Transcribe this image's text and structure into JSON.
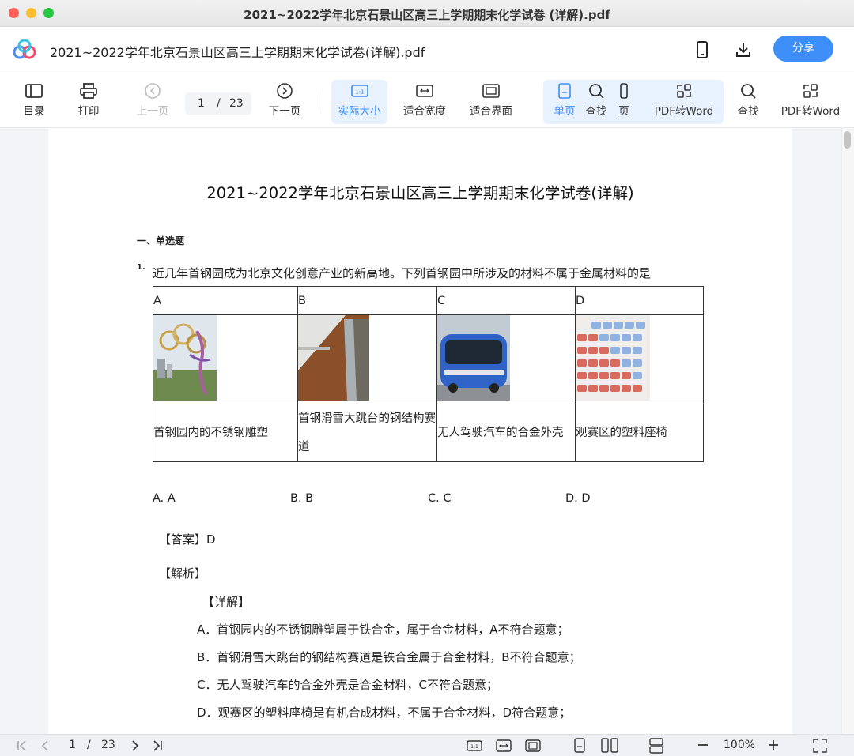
{
  "window": {
    "title": "2021~2022学年北京石景山区高三上学期期末化学试卷 (详解).pdf"
  },
  "header": {
    "file_title": "2021~2022学年北京石景山区高三上学期期末化学试卷(详解).pdf",
    "share_label": "分享",
    "icons": [
      "app-logo-icon",
      "phone-icon",
      "download-icon"
    ]
  },
  "toolbar": {
    "toc": "目录",
    "print": "打印",
    "prev": "上一页",
    "current_page": "1",
    "separator": "/",
    "total_pages": "23",
    "next": "下一页",
    "actual_size": "实际大小",
    "fit_width": "适合宽度",
    "fit_page": "适合界面",
    "single_page": "单页",
    "find": "查找",
    "page_partial": "页",
    "pdf_to_word": "PDF转Word",
    "find2": "查找",
    "pdf_to_word2": "PDF转Word"
  },
  "document": {
    "heading": "2021~2022学年北京石景山区高三上学期期末化学试卷(详解)",
    "section": "一、单选题",
    "question_number": "1.",
    "question_text": "近几年首钢园成为北京文化创意产业的新高地。下列首钢园中所涉及的材料不属于金属材料的是",
    "table": {
      "headers": [
        "A",
        "B",
        "C",
        "D"
      ],
      "image_names": [
        "olympic-rings-sculpture-image",
        "ski-jump-steel-track-image",
        "driverless-bus-image",
        "stadium-plastic-seats-image"
      ],
      "captions": [
        "首钢园内的不锈钢雕塑",
        "首钢滑雪大跳台的钢结构赛道",
        "无人驾驶汽车的合金外壳",
        "观赛区的塑料座椅"
      ]
    },
    "choices": [
      "A. A",
      "B. B",
      "C. C",
      "D. D"
    ],
    "answer": "【答案】D",
    "analysis": "【解析】",
    "detail": "【详解】",
    "explanations": [
      "A．首钢园内的不锈钢雕塑属于铁合金，属于合金材料，A不符合题意；",
      "B．首钢滑雪大跳台的钢结构赛道是铁合金属于合金材料，B不符合题意；",
      "C．无人驾驶汽车的合金外壳是合金材料，C不符合题意；",
      "D．观赛区的塑料座椅是有机合成材料，不属于合金材料，D符合题意；"
    ]
  },
  "statusbar": {
    "current_page": "1",
    "separator": "/",
    "total_pages": "23",
    "zoom": "100%"
  },
  "colors": {
    "accent": "#3d8ef8",
    "active_bg": "#e8f1fe",
    "close": "#ff5f57",
    "minimize": "#febc2e",
    "maximize": "#28c840"
  }
}
